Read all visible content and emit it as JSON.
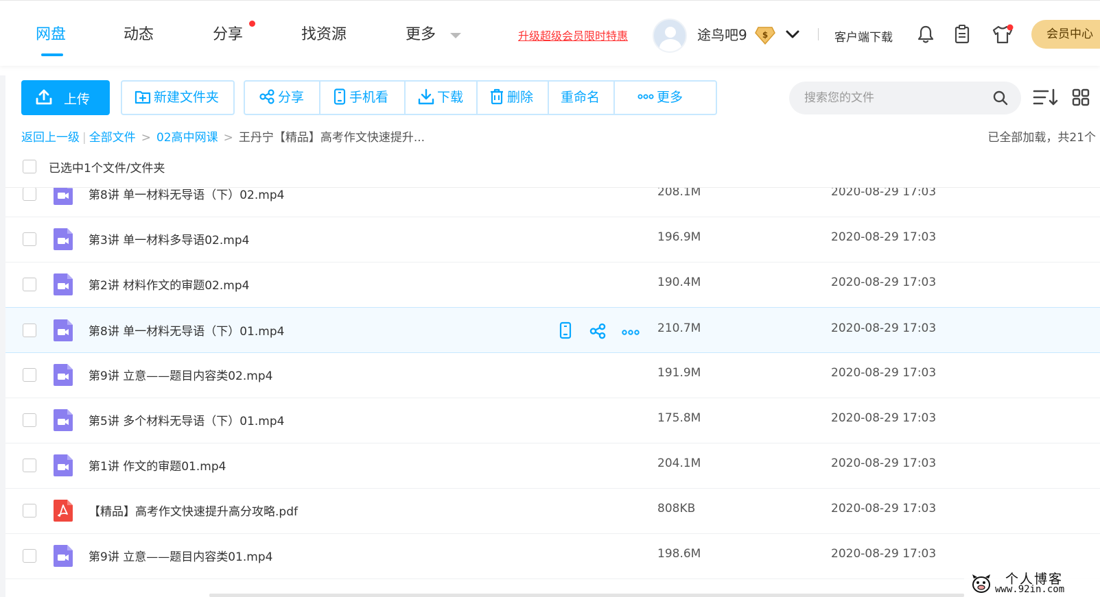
{
  "nav": {
    "tabs": [
      {
        "label": "网盘",
        "active": true
      },
      {
        "label": "动态"
      },
      {
        "label": "分享",
        "badge_dot": true
      },
      {
        "label": "找资源"
      },
      {
        "label": "更多"
      }
    ],
    "promo_link": "升级超级会员限时特惠",
    "username": "途鸟吧9",
    "vip_badge_symbol": "$",
    "client_download": "客户端下载",
    "vip_center": "会员中心",
    "icons": [
      "bell-icon",
      "clipboard-icon",
      "shirt-icon"
    ]
  },
  "toolbar": {
    "upload": "上传",
    "new_folder": "新建文件夹",
    "share": "分享",
    "mobile_view": "手机看",
    "download": "下载",
    "delete": "删除",
    "rename": "重命名",
    "more": "更多",
    "search_placeholder": "搜索您的文件"
  },
  "breadcrumb": {
    "back": "返回上一级",
    "all_files": "全部文件",
    "folder": "02高中网课",
    "current": "王丹宁【精品】高考作文快速提升...",
    "loaded_status": "已全部加载，共21个"
  },
  "selection": {
    "text": "已选中1个文件/文件夹"
  },
  "files": [
    {
      "name": "第8讲 单一材料无导语（下）02.mp4",
      "size": "208.1M",
      "date": "2020-08-29 17:03",
      "type": "video"
    },
    {
      "name": "第3讲 单一材料多导语02.mp4",
      "size": "196.9M",
      "date": "2020-08-29 17:03",
      "type": "video"
    },
    {
      "name": "第2讲 材料作文的审题02.mp4",
      "size": "190.4M",
      "date": "2020-08-29 17:03",
      "type": "video"
    },
    {
      "name": "第8讲 单一材料无导语（下）01.mp4",
      "size": "210.7M",
      "date": "2020-08-29 17:03",
      "type": "video",
      "hover": true
    },
    {
      "name": "第9讲 立意——题目内容类02.mp4",
      "size": "191.9M",
      "date": "2020-08-29 17:03",
      "type": "video"
    },
    {
      "name": "第5讲 多个材料无导语（下）01.mp4",
      "size": "175.8M",
      "date": "2020-08-29 17:03",
      "type": "video"
    },
    {
      "name": "第1讲 作文的审题01.mp4",
      "size": "204.1M",
      "date": "2020-08-29 17:03",
      "type": "video"
    },
    {
      "name": "【精品】高考作文快速提升高分攻略.pdf",
      "size": "808KB",
      "date": "2020-08-29 17:03",
      "type": "pdf"
    },
    {
      "name": "第9讲 立意——题目内容类01.mp4",
      "size": "198.6M",
      "date": "2020-08-29 17:03",
      "type": "video"
    }
  ],
  "colors": {
    "accent": "#06a7ff",
    "video_icon": "#8b7ff0",
    "pdf_icon": "#f0483e",
    "promo": "#ff3333",
    "vip_gold": "#f5d48f"
  },
  "watermark": {
    "line1": "个人博客",
    "line2": "www.92in.com"
  }
}
